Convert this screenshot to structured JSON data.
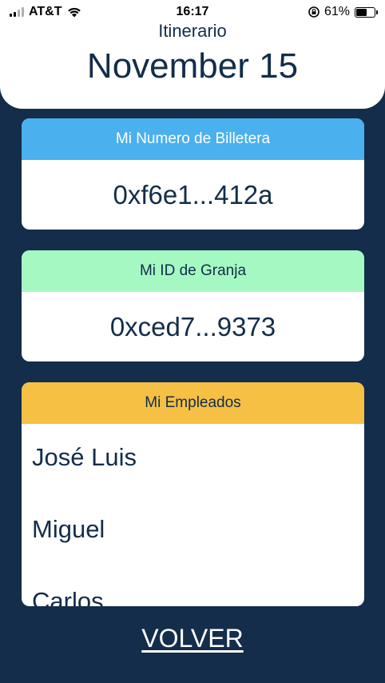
{
  "status_bar": {
    "carrier": "AT&T",
    "time": "16:17",
    "battery": "61%",
    "battery_level": 0.61
  },
  "header": {
    "subtitle": "Itinerario",
    "title": "November 15"
  },
  "wallet_card": {
    "label": "Mi Numero de Billetera",
    "value": "0xf6e1...412a",
    "accent": "#4ab0ee"
  },
  "farm_card": {
    "label": "Mi ID de Granja",
    "value": "0xced7...9373",
    "accent": "#a6f8c3"
  },
  "employees_card": {
    "label": "Mi Empleados",
    "accent": "#f5c043",
    "items": [
      "José Luis",
      "Miguel",
      "Carlos"
    ]
  },
  "back_button": {
    "label": "VOLVER"
  },
  "colors": {
    "background": "#132d4a",
    "text": "#132d4a"
  },
  "icons": [
    "signal-icon",
    "wifi-icon",
    "rotation-lock-icon",
    "battery-icon"
  ]
}
